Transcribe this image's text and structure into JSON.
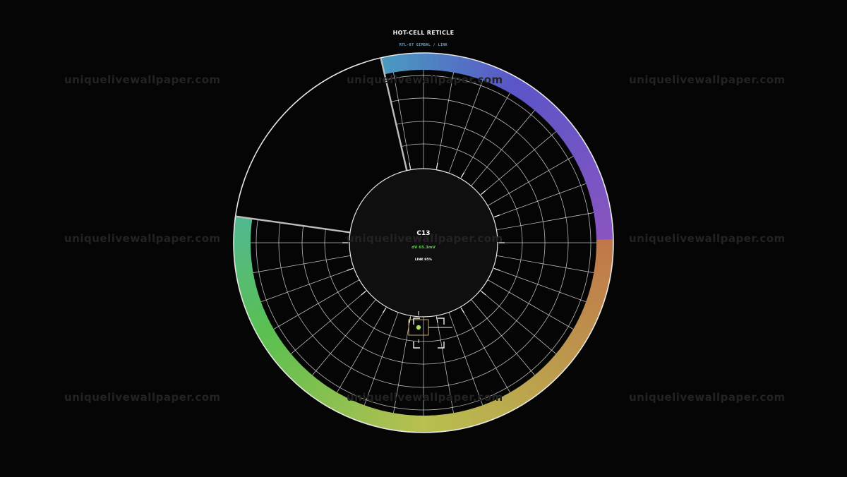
{
  "header": {
    "title": "HOT-CELL RETICLE",
    "subtitle": "RTL-07 GIMBAL / LINK"
  },
  "center": {
    "cell_label": "C13",
    "voltage": "dV 65.3mV",
    "link": "LINK 95%"
  },
  "watermark": {
    "text": "uniquelivewallpaper.com"
  },
  "colors": {
    "background": "#050505",
    "grid": "#d8d8d8",
    "rim": "#e8e8e8",
    "hub": "#0f0f0f",
    "target_dot": "#b6e05a",
    "target_box": "#c9a76a",
    "voltage": "#5fd14a",
    "ring_stops": [
      "#4a9bc0",
      "#5a55c8",
      "#8a55c0",
      "#c0784a",
      "#b8c050",
      "#5ac050",
      "#52b890"
    ]
  },
  "icons": {
    "target": "crosshair-target-icon"
  }
}
